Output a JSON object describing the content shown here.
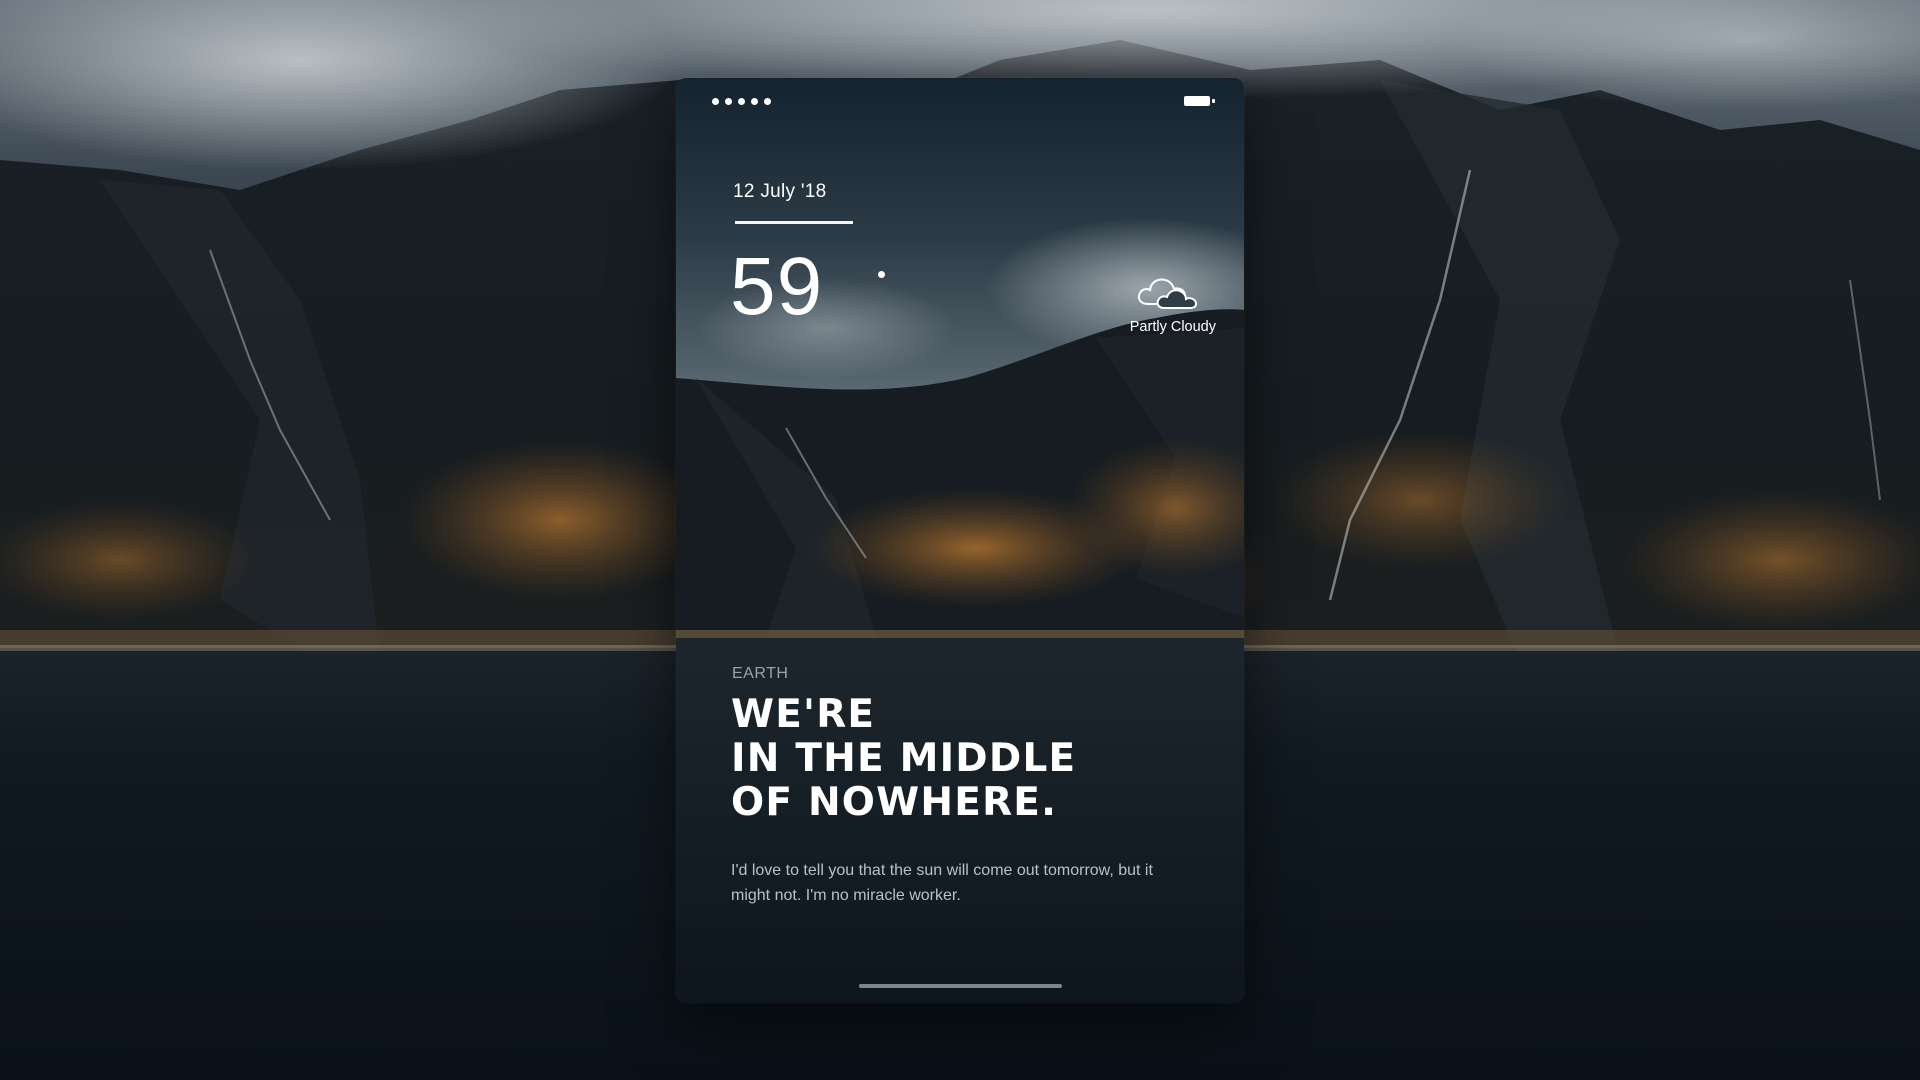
{
  "status_bar": {
    "signal_dots": 5,
    "battery_icon": "battery-icon"
  },
  "weather": {
    "date": "12 July '18",
    "temperature": "59",
    "condition": "Partly Cloudy",
    "condition_icon": "cloud-icon"
  },
  "story": {
    "place": "EARTH",
    "headline_lines": [
      "WE'RE",
      "IN THE MIDDLE",
      "OF NOWHERE."
    ],
    "body": "I'd love to tell you that the sun will come out tomorrow, but it might not. I'm no miracle worker."
  },
  "colors": {
    "text": "#ffffff",
    "muted": "#9aa3aa",
    "body": "#b9c0c6",
    "sky": "#3a4650",
    "water": "#0d151c",
    "grass": "#8c5e2a"
  }
}
